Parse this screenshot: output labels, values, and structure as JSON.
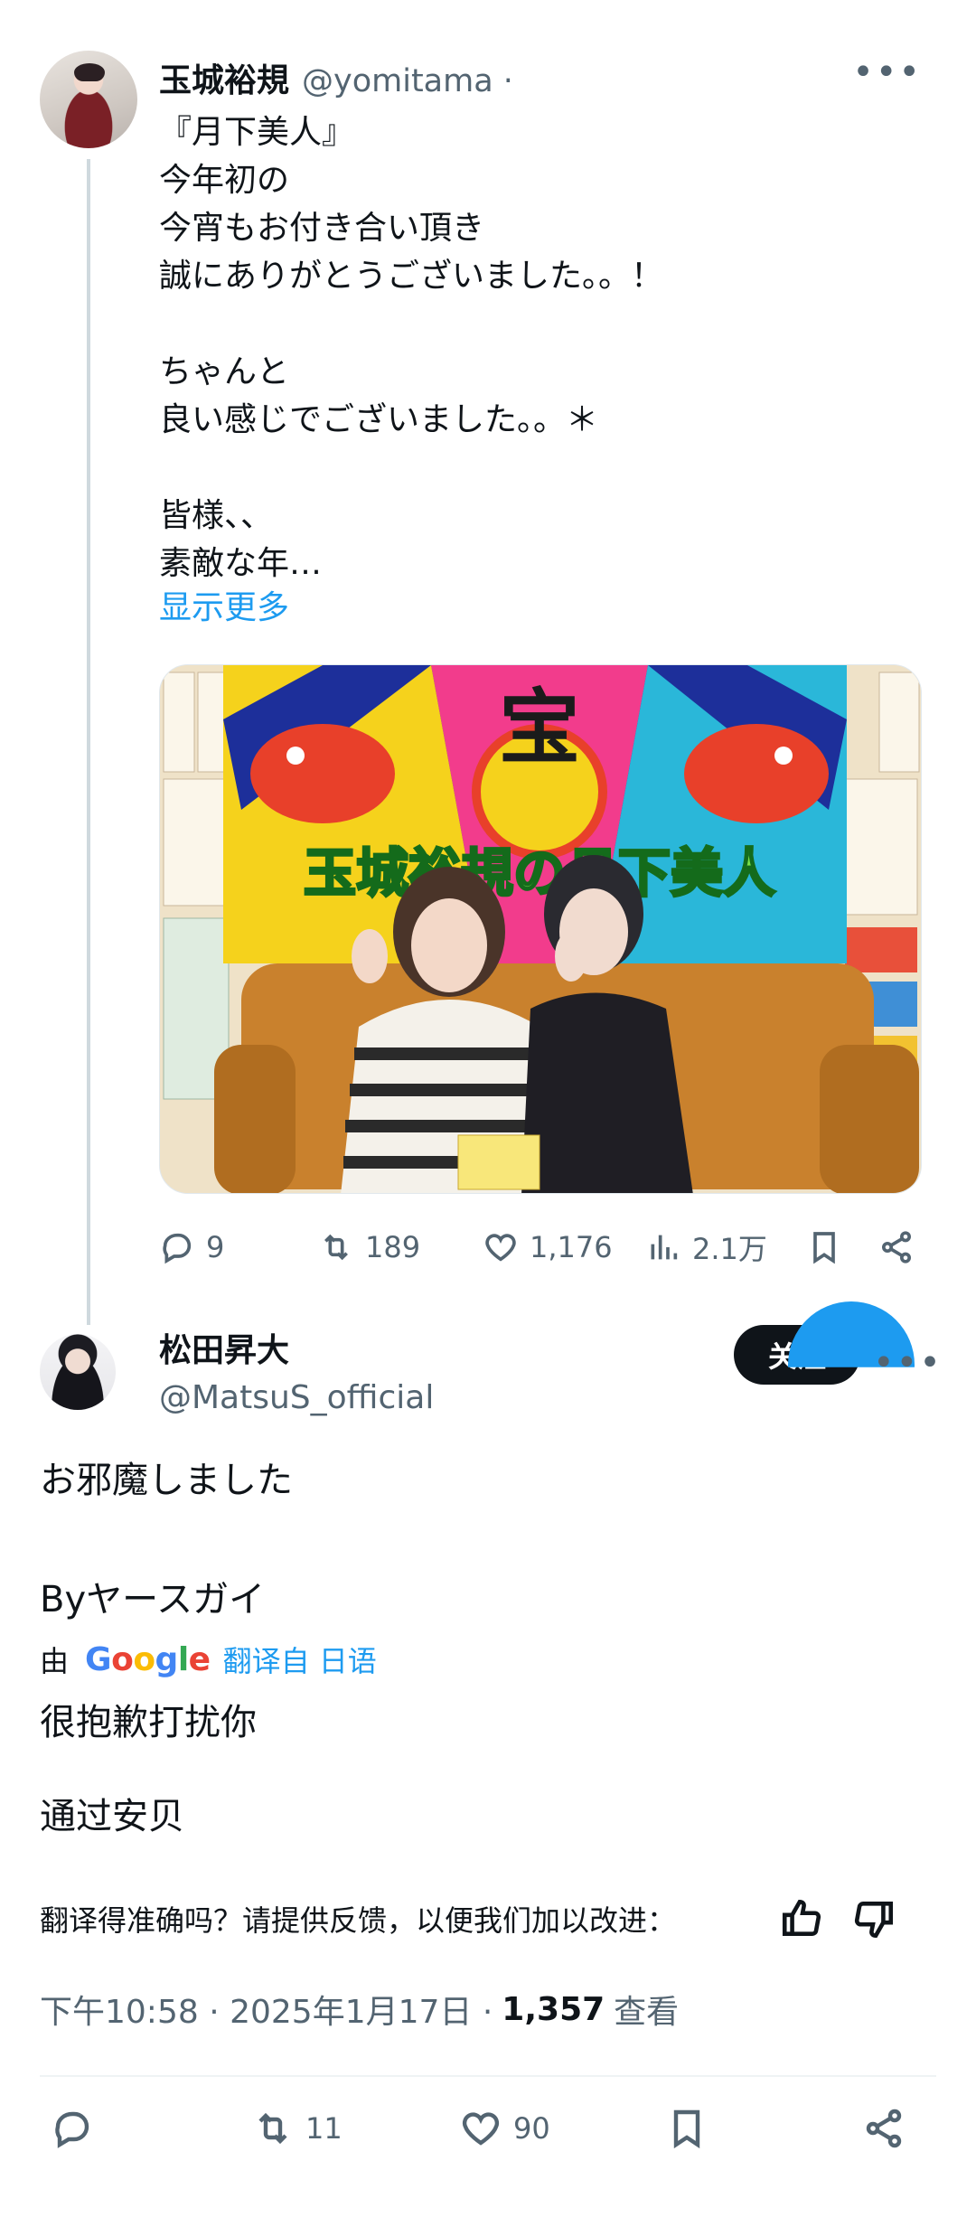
{
  "parent_tweet": {
    "display_name": "玉城裕規",
    "handle": "@yomitama ·",
    "more_icon": "more-horizontal-icon",
    "lines": [
      "『月下美人』",
      "今年初の",
      "今宵もお付き合い頂き",
      "誠にありがとうございました。。！",
      "",
      "ちゃんと",
      "良い感じでございました。。＊",
      "",
      "皆様、、",
      "素敵な年…"
    ],
    "show_more": "显示更多",
    "photo_caption": "玉城裕規の月下美人",
    "photo_sign_text": "宝",
    "stats": {
      "replies": "9",
      "retweets": "189",
      "likes": "1,176",
      "views": "2.1万"
    }
  },
  "reply": {
    "display_name": "松田昇大",
    "handle": "@MatsuS_official",
    "follow_label": "关注",
    "original_line1": "お邪魔しました",
    "original_line2": "Byヤースガイ",
    "translated_by_prefix": "由",
    "google": {
      "G": "G",
      "o1": "o",
      "o2": "o",
      "g": "g",
      "l": "l",
      "e": "e"
    },
    "translate_link": "翻译自 日语",
    "translated_line1": "很抱歉打扰你",
    "translated_line2": "通过安贝",
    "feedback_prompt": "翻译得准确吗？请提供反馈，以便我们加以改进：",
    "timestamp": "下午10:58 · 2025年1月17日 ·",
    "views_count": "1,357",
    "views_label": "查看",
    "stats": {
      "retweets": "11",
      "likes": "90"
    }
  },
  "colors": {
    "accent": "#1d9bf0",
    "text": "#0f1419",
    "secondary": "#536471"
  }
}
